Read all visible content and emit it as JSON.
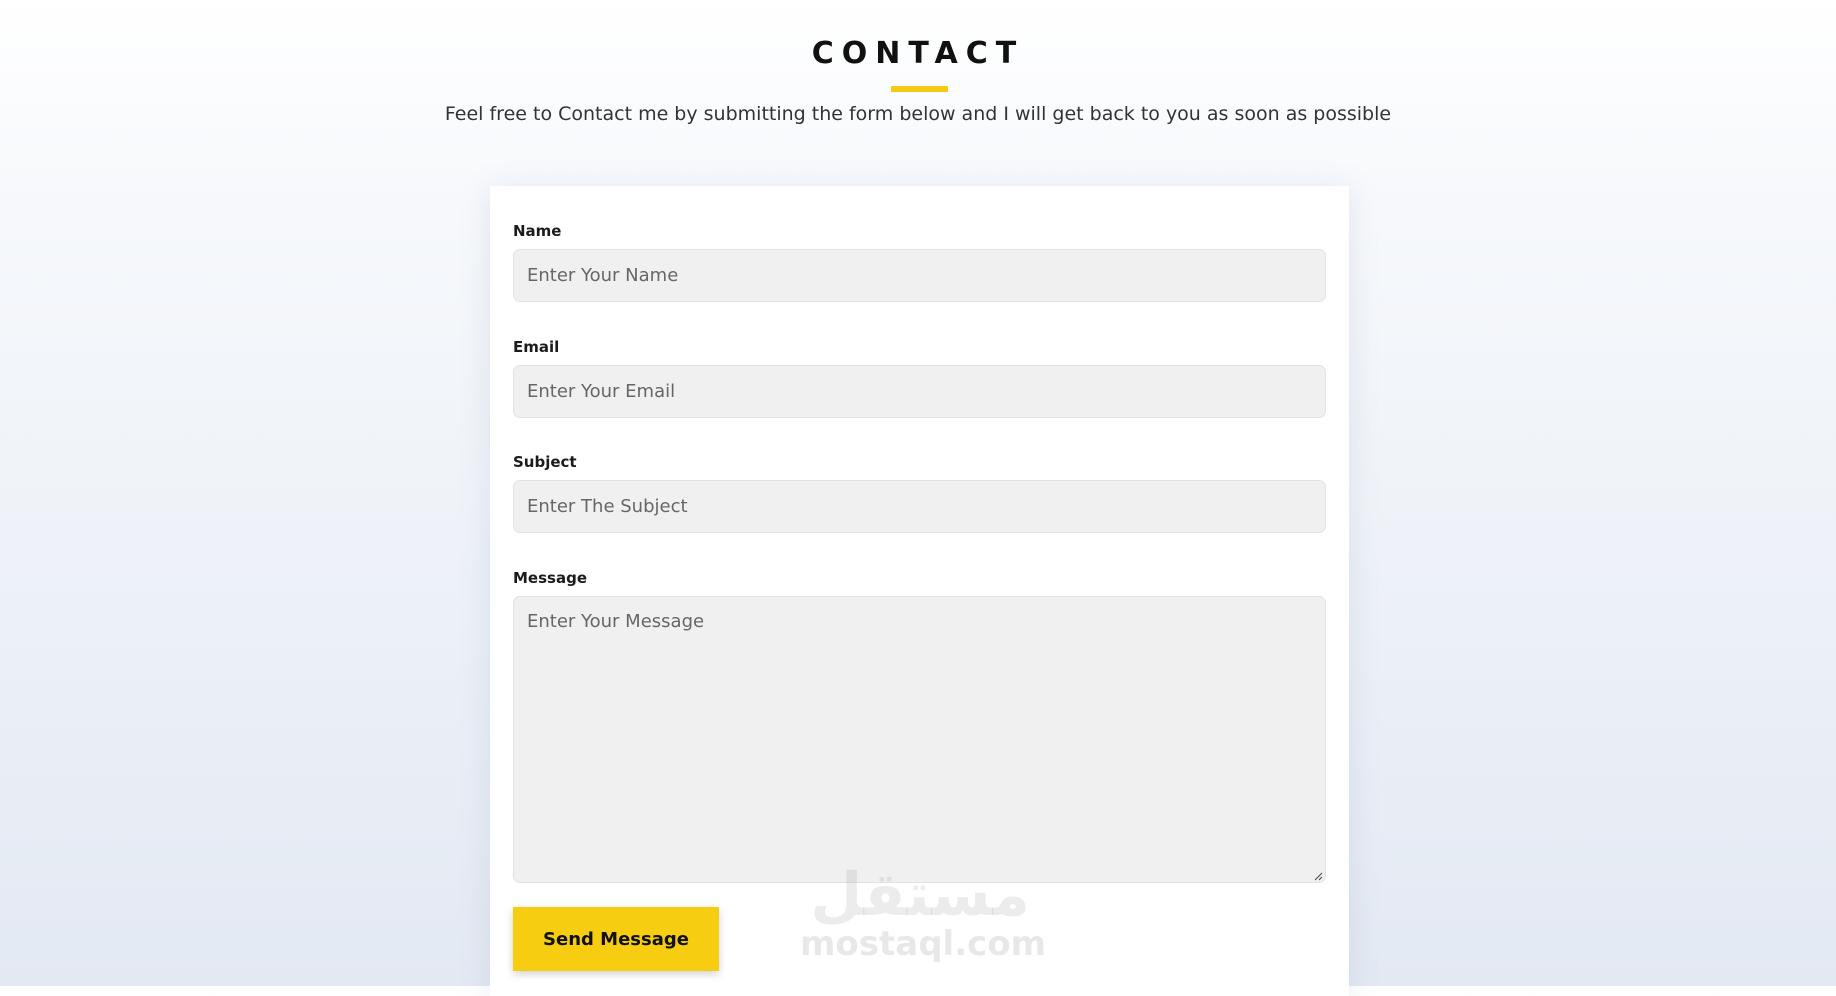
{
  "header": {
    "title": "CONTACT",
    "subtitle": "Feel free to Contact me by submitting the form below and I will get back to you as soon as possible"
  },
  "form": {
    "name": {
      "label": "Name",
      "placeholder": "Enter Your Name"
    },
    "email": {
      "label": "Email",
      "placeholder": "Enter Your Email"
    },
    "subject": {
      "label": "Subject",
      "placeholder": "Enter The Subject"
    },
    "message": {
      "label": "Message",
      "placeholder": "Enter Your Message"
    },
    "submit_label": "Send Message"
  },
  "watermark": {
    "arabic": "مستقل",
    "latin": "mostaql.com"
  },
  "colors": {
    "accent": "#f7cd11",
    "input_background": "#f0f0f0",
    "card_background": "#ffffff"
  }
}
